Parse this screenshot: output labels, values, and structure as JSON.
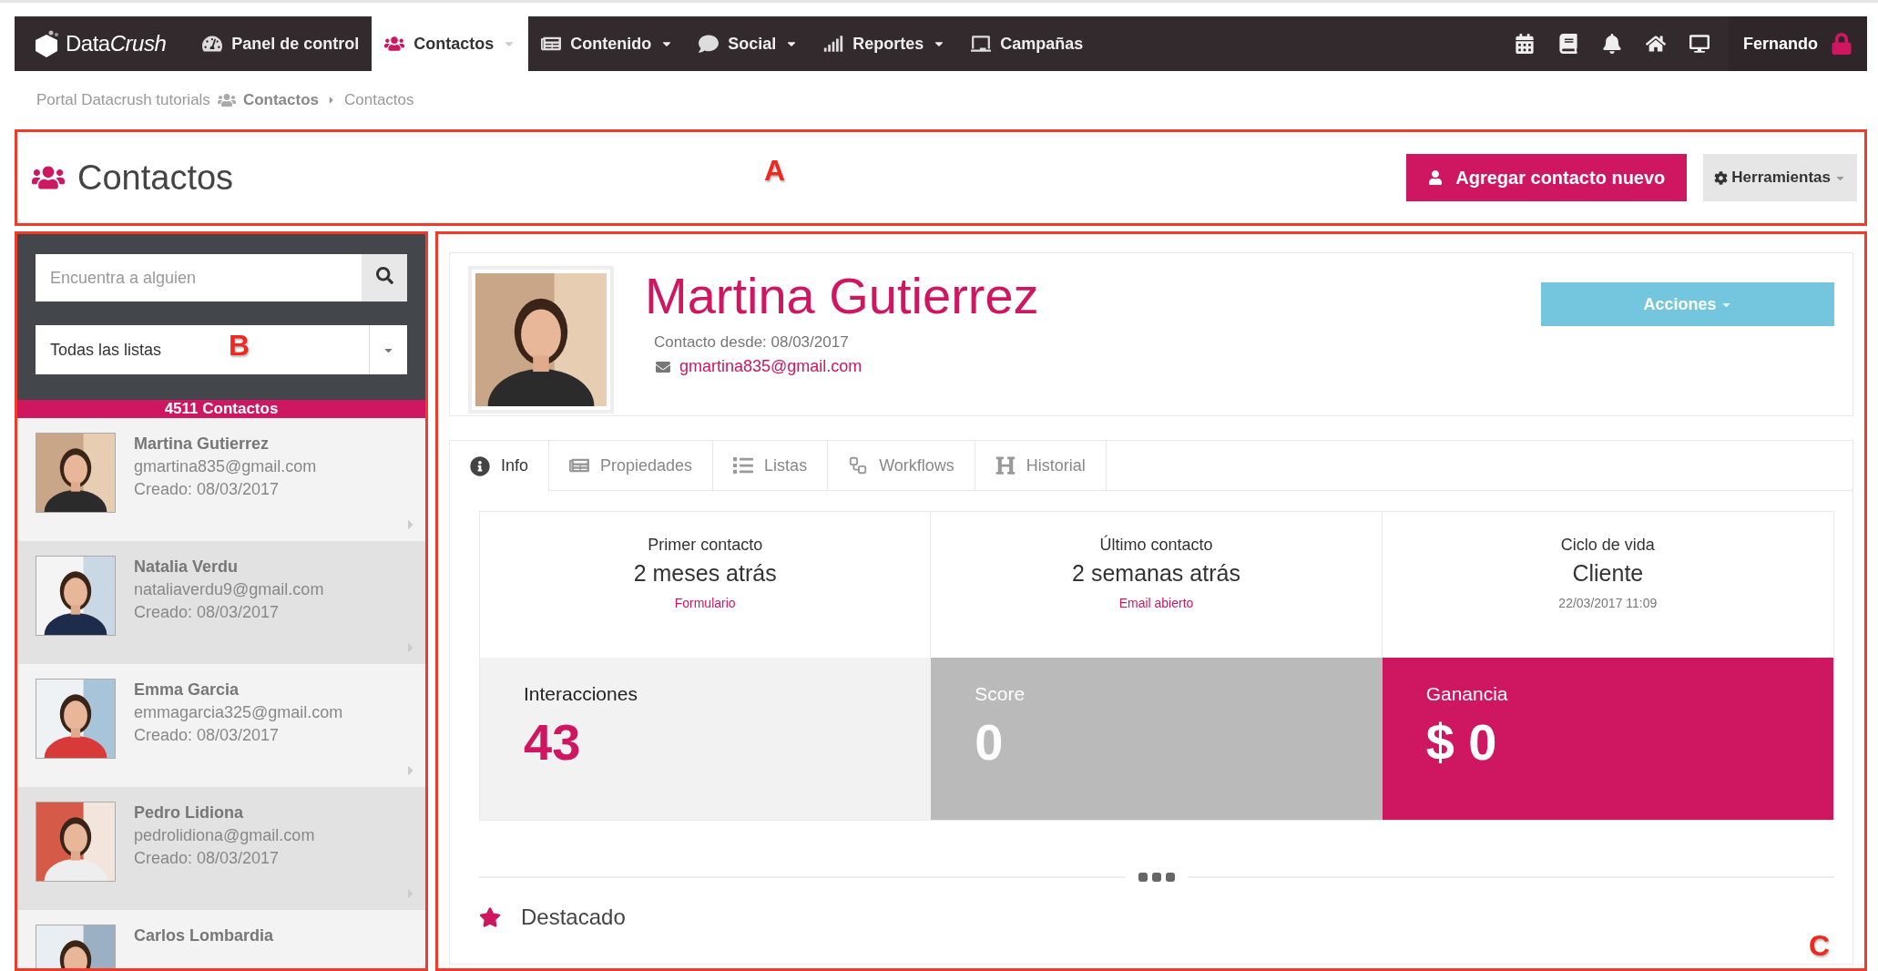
{
  "nav": {
    "logo": [
      "Data",
      "Crush"
    ],
    "items": [
      {
        "label": "Panel de control",
        "has_menu": false,
        "selected": false
      },
      {
        "label": "Contactos",
        "has_menu": true,
        "selected": true
      },
      {
        "label": "Contenido",
        "has_menu": true,
        "selected": false
      },
      {
        "label": "Social",
        "has_menu": true,
        "selected": false
      },
      {
        "label": "Reportes",
        "has_menu": true,
        "selected": false
      },
      {
        "label": "Campañas",
        "has_menu": false,
        "selected": false
      }
    ],
    "user": "Fernando"
  },
  "breadcrumb": [
    {
      "label": "Portal Datacrush tutorials",
      "kind": "link"
    },
    {
      "label": "Contactos",
      "kind": "section"
    },
    {
      "label": "Contactos",
      "kind": "current"
    }
  ],
  "header": {
    "title": "Contactos",
    "annotation": "A",
    "primary_button": "Agregar contacto nuevo",
    "tools_button": "Herramientas"
  },
  "sidebar": {
    "annotation": "B",
    "search": {
      "placeholder": "Encuentra a alguien"
    },
    "list_filter": "Todas las listas",
    "count": "4511 Contactos",
    "contacts": [
      {
        "name": "Martina Gutierrez",
        "email": "gmartina835@gmail.com",
        "created": "Creado: 08/03/2017"
      },
      {
        "name": "Natalia Verdu",
        "email": "nataliaverdu9@gmail.com",
        "created": "Creado: 08/03/2017"
      },
      {
        "name": "Emma Garcia",
        "email": "emmagarcia325@gmail.com",
        "created": "Creado: 08/03/2017"
      },
      {
        "name": "Pedro Lidiona",
        "email": "pedrolidiona@gmail.com",
        "created": "Creado: 08/03/2017"
      },
      {
        "name": "Carlos Lombardia"
      }
    ]
  },
  "detail": {
    "annotation": "C",
    "name": "Martina Gutierrez",
    "since": "Contacto desde: 08/03/2017",
    "email": "gmartina835@gmail.com",
    "actions_button": "Acciones",
    "tabs": [
      {
        "label": "Info",
        "selected": true
      },
      {
        "label": "Propiedades",
        "selected": false
      },
      {
        "label": "Listas",
        "selected": false
      },
      {
        "label": "Workflows",
        "selected": false
      },
      {
        "label": "Historial",
        "selected": false
      }
    ],
    "summary": [
      {
        "label": "Primer contacto",
        "value": "2 meses atrás",
        "note": "Formulario"
      },
      {
        "label": "Último contacto",
        "value": "2 semanas atrás",
        "note": "Email abierto"
      },
      {
        "label": "Ciclo de vida",
        "value": "Cliente",
        "note": "22/03/2017 11:09"
      }
    ],
    "metrics": [
      {
        "label": "Interacciones",
        "value": "43",
        "kind": "plain"
      },
      {
        "label": "Score",
        "value": "0",
        "kind": "neutral"
      },
      {
        "label": "Ganancia",
        "value": "$ 0",
        "kind": "accent"
      }
    ],
    "featured": "Destacado"
  }
}
